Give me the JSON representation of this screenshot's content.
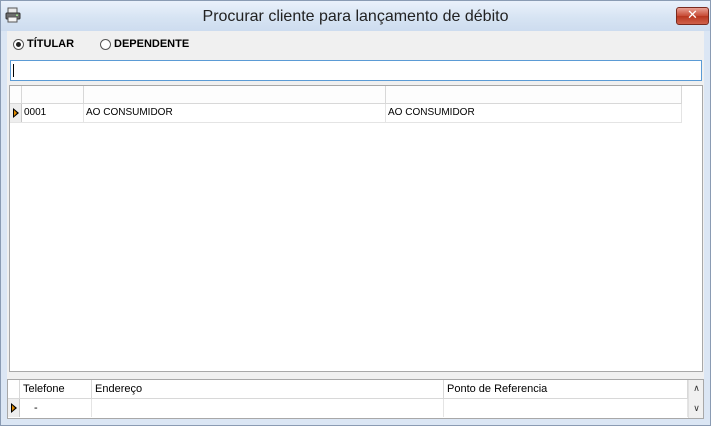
{
  "window": {
    "title": "Procurar cliente para lançamento de débito",
    "close_glyph": "✕",
    "app_icon": "printer-icon"
  },
  "mode": {
    "options": [
      {
        "label": "TÍTULAR",
        "checked": true
      },
      {
        "label": "DEPENDENTE",
        "checked": false
      }
    ]
  },
  "search": {
    "value": "",
    "placeholder": ""
  },
  "clients_grid": {
    "headers": [
      "",
      "",
      ""
    ],
    "rows": [
      {
        "code": "0001",
        "name": "AO CONSUMIDOR",
        "fantasy": "AO CONSUMIDOR",
        "current": true
      }
    ]
  },
  "details_grid": {
    "headers": [
      "Telefone",
      "Endereço",
      "Ponto de Referencia"
    ],
    "rows": [
      {
        "phone": "-",
        "address": "",
        "reference": "",
        "current": true
      }
    ]
  },
  "scrollbar": {
    "up_glyph": "∧",
    "down_glyph": "∨"
  },
  "colors": {
    "title_bg": "#d7e4f3",
    "close_red": "#c74a35",
    "focus_border": "#5b9bd5"
  }
}
